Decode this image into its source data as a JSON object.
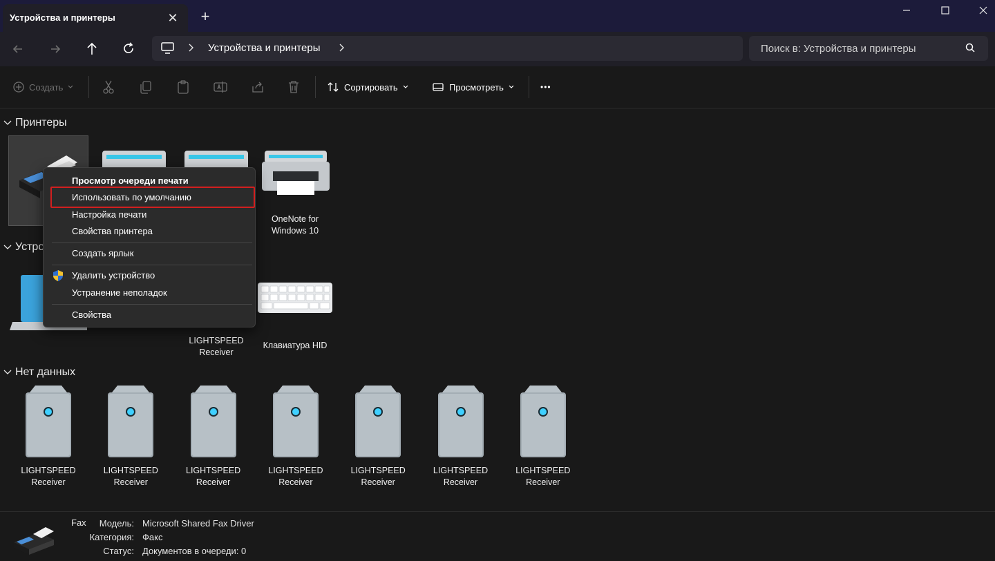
{
  "window": {
    "tab_title": "Устройства и принтеры",
    "tab_close": "✕",
    "tab_add": "+"
  },
  "address": {
    "crumb": "Устройства и принтеры",
    "search_placeholder": "Поиск в: Устройства и принтеры"
  },
  "toolbar": {
    "create_label": "Создать",
    "sort_label": "Сортировать",
    "view_label": "Просмотреть",
    "more_label": "•••"
  },
  "groups": {
    "printers": "Принтеры",
    "devices": "Устро",
    "no_data": "Нет данных"
  },
  "printers": [
    {
      "label": ""
    },
    {
      "label": ""
    },
    {
      "label": ""
    },
    {
      "label": "OneNote for Windows 10"
    }
  ],
  "devices": [
    {
      "label": ""
    },
    {
      "label": ""
    },
    {
      "label": "LIGHTSPEED Receiver"
    },
    {
      "label": "Клавиатура HID"
    }
  ],
  "no_data_items": [
    {
      "label": "LIGHTSPEED Receiver"
    },
    {
      "label": "LIGHTSPEED Receiver"
    },
    {
      "label": "LIGHTSPEED Receiver"
    },
    {
      "label": "LIGHTSPEED Receiver"
    },
    {
      "label": "LIGHTSPEED Receiver"
    },
    {
      "label": "LIGHTSPEED Receiver"
    },
    {
      "label": "LIGHTSPEED Receiver"
    }
  ],
  "context_menu": {
    "view_queue": "Просмотр очереди печати",
    "set_default": "Использовать по умолчанию",
    "print_prefs": "Настройка печати",
    "printer_props": "Свойства принтера",
    "create_shortcut": "Создать ярлык",
    "remove_device": "Удалить устройство",
    "troubleshoot": "Устранение неполадок",
    "properties": "Свойства"
  },
  "details": {
    "name": "Fax",
    "model_key": "Модель:",
    "model_val": "Microsoft Shared Fax Driver",
    "category_key": "Категория:",
    "category_val": "Факс",
    "status_key": "Статус:",
    "status_val": "Документов в очереди: 0"
  },
  "colors": {
    "highlight_border": "#d21f1f",
    "accent_led": "#3fd0ff"
  }
}
